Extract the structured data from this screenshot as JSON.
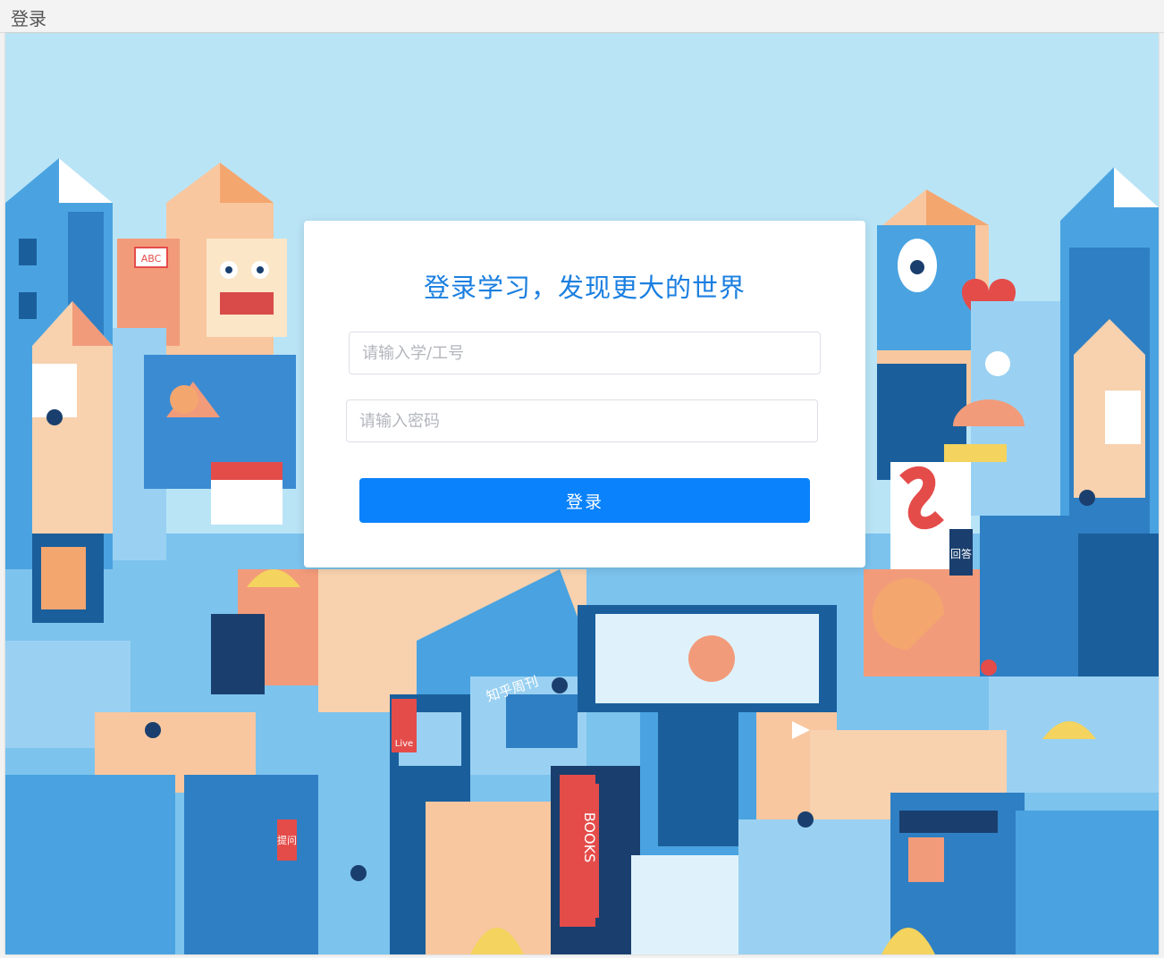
{
  "window": {
    "title": "登录"
  },
  "login": {
    "heading": "登录学习，发现更大的世界",
    "username_placeholder": "请输入学/工号",
    "username_value": "",
    "password_placeholder": "请输入密码",
    "password_value": "",
    "submit_label": "登录"
  },
  "background": {
    "sign_labels": [
      "ABC",
      "知乎周刊",
      "BOOKS",
      "Live",
      "回答",
      "提问"
    ],
    "colors": {
      "sky": "#b9e4f6",
      "accent": "#0a82fb",
      "heading": "#1b7fe0"
    }
  }
}
